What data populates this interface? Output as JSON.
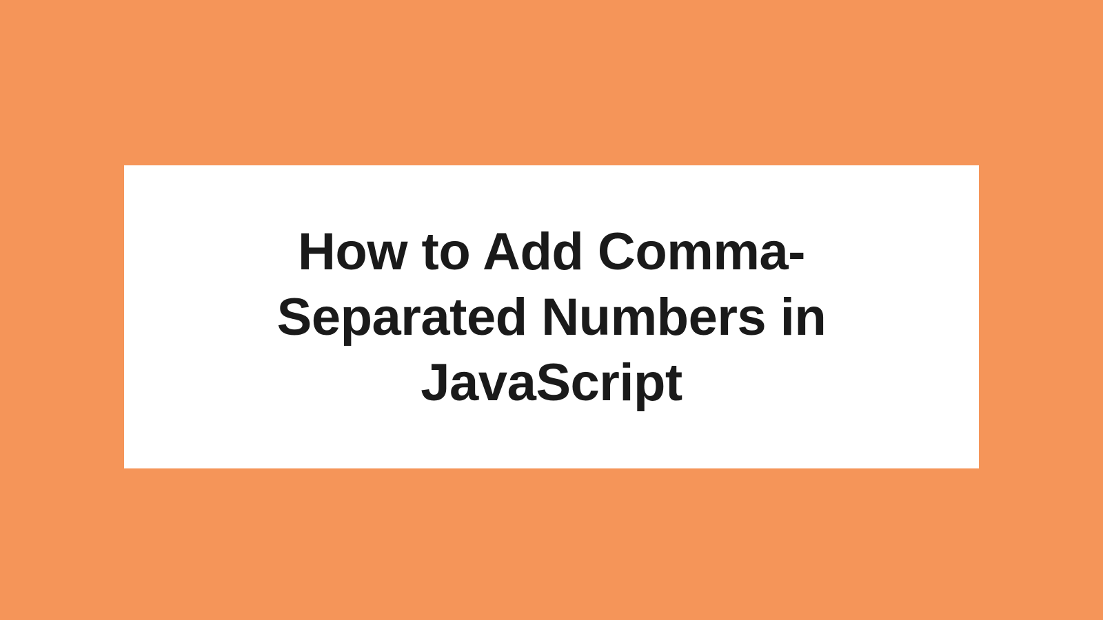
{
  "title": "How to Add Comma-Separated Numbers in JavaScript",
  "colors": {
    "background": "#f59559",
    "card": "#ffffff",
    "text": "#1a1a1a"
  }
}
